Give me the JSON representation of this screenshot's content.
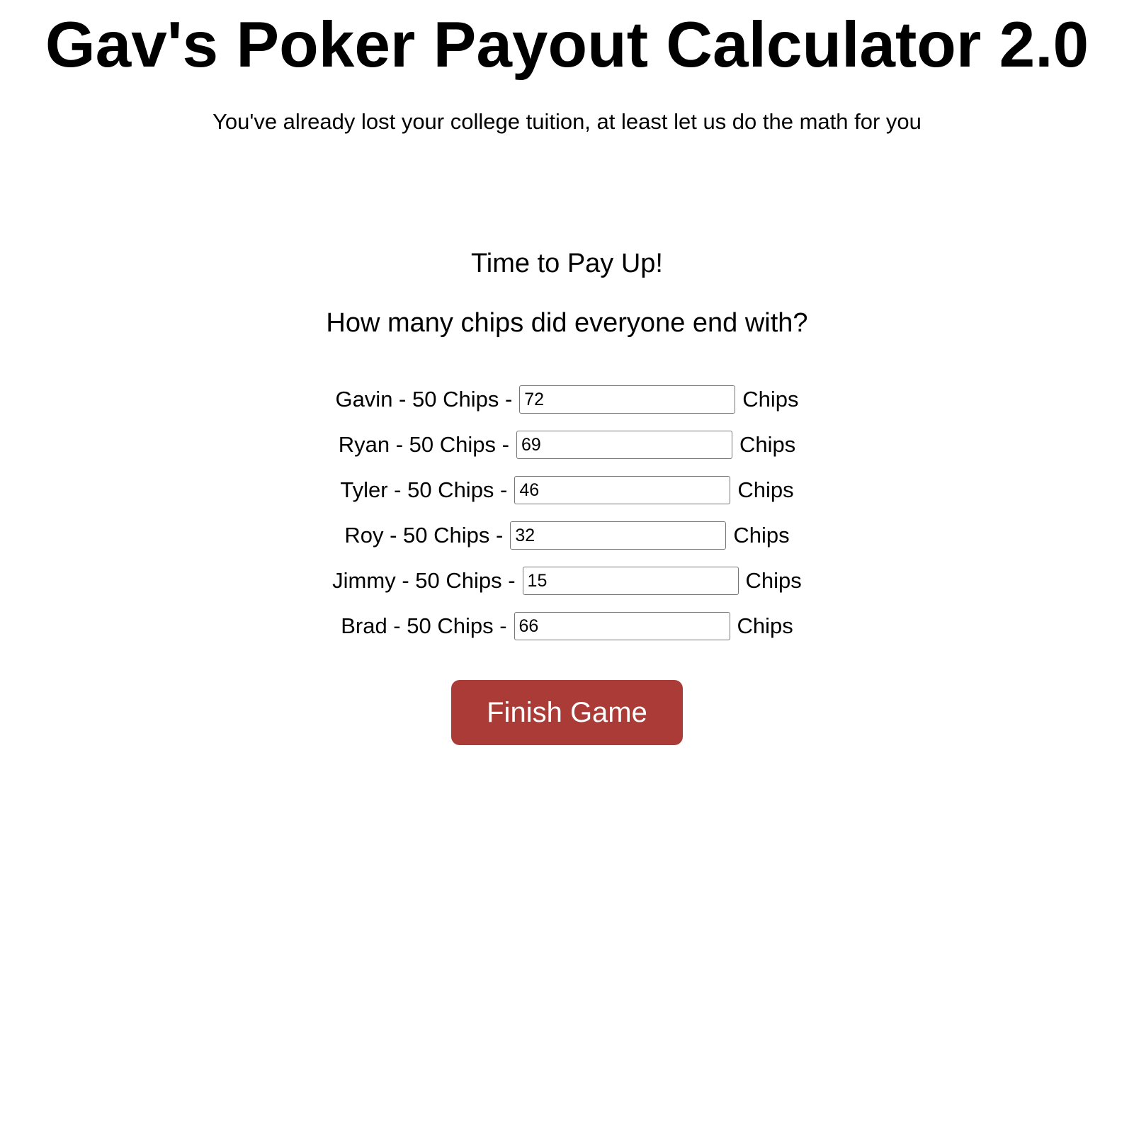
{
  "header": {
    "title": "Gav's Poker Payout Calculator 2.0",
    "tagline": "You've already lost your college tuition, at least let us do the math for you"
  },
  "main": {
    "section_heading": "Time to Pay Up!",
    "prompt": "How many chips did everyone end with?",
    "unit_label": "Chips",
    "players": [
      {
        "label": "Gavin - 50 Chips -",
        "value": "72"
      },
      {
        "label": "Ryan - 50 Chips -",
        "value": "69"
      },
      {
        "label": "Tyler - 50 Chips -",
        "value": "46"
      },
      {
        "label": "Roy - 50 Chips -",
        "value": "32"
      },
      {
        "label": "Jimmy - 50 Chips -",
        "value": "15"
      },
      {
        "label": "Brad - 50 Chips -",
        "value": "66"
      }
    ],
    "finish_button": {
      "label": "Finish Game",
      "color": "#ab3b36"
    }
  }
}
